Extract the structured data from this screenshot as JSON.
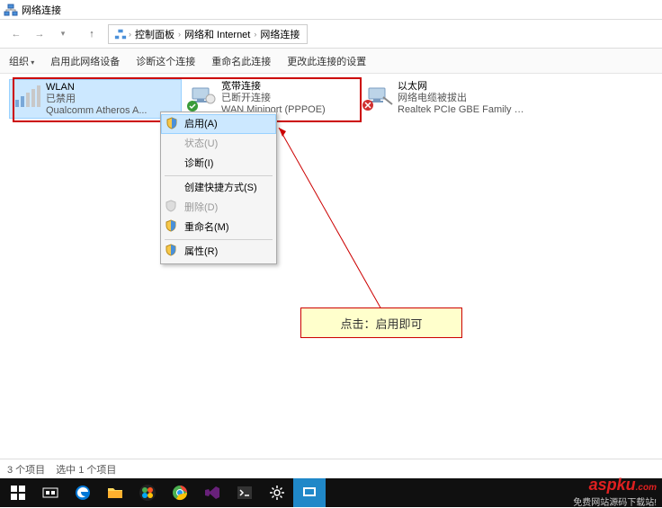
{
  "window": {
    "title": "网络连接"
  },
  "breadcrumb": {
    "root_icon": "network",
    "items": [
      "控制面板",
      "网络和 Internet",
      "网络连接"
    ]
  },
  "toolbar": {
    "organize": "组织",
    "enable": "启用此网络设备",
    "diagnose": "诊断这个连接",
    "rename": "重命名此连接",
    "change": "更改此连接的设置"
  },
  "connections": [
    {
      "name": "WLAN",
      "status": "已禁用",
      "device": "Qualcomm Atheros A...",
      "selected": true,
      "icon": "wifi"
    },
    {
      "name": "宽带连接",
      "status": "已断开连接",
      "device": "WAN Miniport (PPPOE)",
      "selected": false,
      "icon": "wan",
      "ok": true
    },
    {
      "name": "以太网",
      "status": "网络电缆被拔出",
      "device": "Realtek PCIe GBE Family Contr...",
      "selected": false,
      "icon": "ethernet",
      "error": true
    }
  ],
  "context_menu": [
    {
      "label": "启用(A)",
      "shield": true,
      "hover": true
    },
    {
      "label": "状态(U)",
      "disabled": true
    },
    {
      "label": "诊断(I)"
    },
    {
      "sep": true
    },
    {
      "label": "创建快捷方式(S)"
    },
    {
      "label": "删除(D)",
      "shield": true,
      "disabled": true
    },
    {
      "label": "重命名(M)",
      "shield": true
    },
    {
      "sep": true
    },
    {
      "label": "属性(R)",
      "shield": true
    }
  ],
  "annotation": {
    "text": "点击：启用即可"
  },
  "statusbar": {
    "count": "3 个项目",
    "selected": "选中 1 个项目"
  },
  "footer": {
    "logo": "aspku",
    "tld": ".com",
    "sub": "免费网站源码下载站!"
  }
}
